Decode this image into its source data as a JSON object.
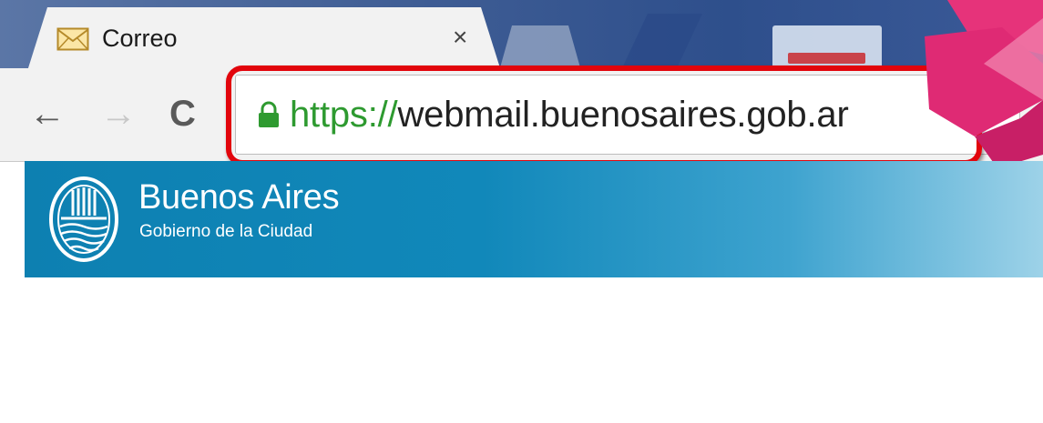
{
  "browser": {
    "tab": {
      "title": "Correo",
      "icon": "envelope-icon",
      "close_label": "×"
    },
    "toolbar": {
      "back_icon": "back-arrow-icon",
      "back_label": "←",
      "forward_icon": "forward-arrow-icon",
      "forward_label": "→",
      "reload_icon": "reload-icon",
      "reload_label": "C"
    },
    "address_bar": {
      "secure_icon": "lock-icon",
      "scheme": "https://",
      "host": "webmail.buenosaires.gob.ar"
    }
  },
  "site": {
    "title": "Buenos Aires",
    "subtitle": "Gobierno de la Ciudad",
    "logo_icon": "city-seal-icon"
  },
  "colors": {
    "highlight": "#e2050c",
    "secure_green": "#2e9a30",
    "header_blue": "#0d80b1",
    "titlebar_blue": "#3f5d94",
    "accent_pink": "#e6337a"
  }
}
